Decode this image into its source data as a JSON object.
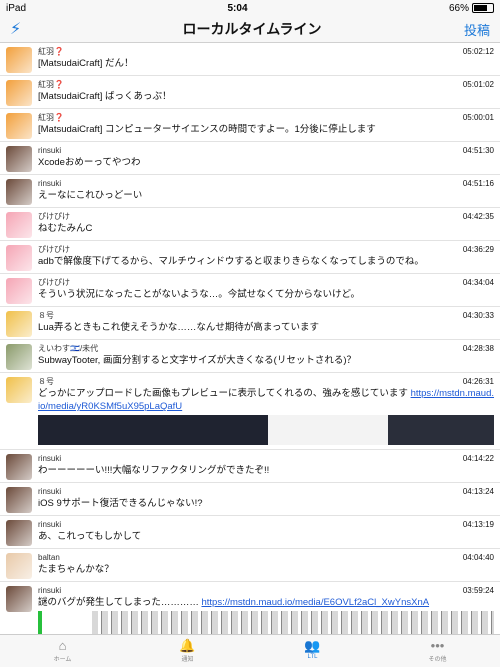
{
  "statusbar": {
    "device": "iPad",
    "time": "5:04",
    "battery": "66%"
  },
  "nav": {
    "title": "ローカルタイムライン",
    "post_label": "投稿",
    "bolt": "⚡"
  },
  "colors": {
    "accent": "#1e7ad9",
    "link": "#1e5ad6"
  },
  "posts": [
    {
      "name": "紅羽❓",
      "time": "05:02:12",
      "text": "[MatsudaiCraft] だん！",
      "avatar_color": "#f2a03c"
    },
    {
      "name": "紅羽❓",
      "time": "05:01:02",
      "text": "[MatsudaiCraft] ばっくあっぷ！",
      "avatar_color": "#f2a03c"
    },
    {
      "name": "紅羽❓",
      "time": "05:00:01",
      "text": "[MatsudaiCraft] コンピューターサイエンスの時間ですよー。1分後に停止します",
      "avatar_color": "#f2a03c"
    },
    {
      "name": "rinsuki",
      "time": "04:51:30",
      "text": "Xcodeおめーってやつわ",
      "avatar_color": "#6b4a3a"
    },
    {
      "name": "rinsuki",
      "time": "04:51:16",
      "text": "えーなにこれひっどーい",
      "avatar_color": "#6b4a3a"
    },
    {
      "name": "ぴけぴけ",
      "time": "04:42:35",
      "text": "ねむたみんC",
      "avatar_color": "#f5a5b5"
    },
    {
      "name": "ぴけぴけ",
      "time": "04:36:29",
      "text": "adbで解像度下げてるから、マルチウィンドウすると収まりきらなくなってしまうのでね。",
      "avatar_color": "#f5a5b5"
    },
    {
      "name": "ぴけぴけ",
      "time": "04:34:04",
      "text": "そういう状況になったことがないような…。今試せなくて分からないけど。",
      "avatar_color": "#f5a5b5"
    },
    {
      "name": "８号",
      "time": "04:30:33",
      "text": "Lua弄るときもこれ使えそうかな……なんせ期待が高まっています",
      "avatar_color": "#f0c04a"
    },
    {
      "name": "えいわす🇮🇱/未代",
      "time": "04:28:38",
      "text": "SubwayTooter, 画面分割すると文字サイズが大きくなる(リセットされる)？",
      "avatar_color": "#8a9a6a"
    },
    {
      "name": "８号",
      "time": "04:26:31",
      "text": "どっかにアップロードした画像もプレビューに表示してくれるの、強みを感じています",
      "link": "https://mstdn.maud.io/media/yR0KSMf5uX95pLaQafU",
      "avatar_color": "#f0c04a"
    },
    {
      "name": "rinsuki",
      "time": "04:14:22",
      "text": "わーーーーーい!!!大幅なリファクタリングができたぞ!!",
      "avatar_color": "#6b4a3a"
    },
    {
      "name": "rinsuki",
      "time": "04:13:24",
      "text": "iOS 9サポート復活できるんじゃない!?",
      "avatar_color": "#6b4a3a"
    },
    {
      "name": "rinsuki",
      "time": "04:13:19",
      "text": "あ、これってもしかして",
      "avatar_color": "#6b4a3a"
    },
    {
      "name": "baltan",
      "time": "04:04:40",
      "text": "たまちゃんかな？",
      "avatar_color": "#e8c9a8"
    },
    {
      "name": "rinsuki",
      "time": "03:59:24",
      "text": "謎のバグが発生してしまった………… ",
      "link": "https://mstdn.maud.io/media/E6OVLf2aCl_XwYnsXnA",
      "avatar_color": "#6b4a3a"
    }
  ],
  "tabs": [
    {
      "label": "ホーム",
      "icon": "⌂"
    },
    {
      "label": "通知",
      "icon": "🔔"
    },
    {
      "label": "LTL",
      "icon": "👥"
    },
    {
      "label": "その他",
      "icon": "•••"
    }
  ]
}
